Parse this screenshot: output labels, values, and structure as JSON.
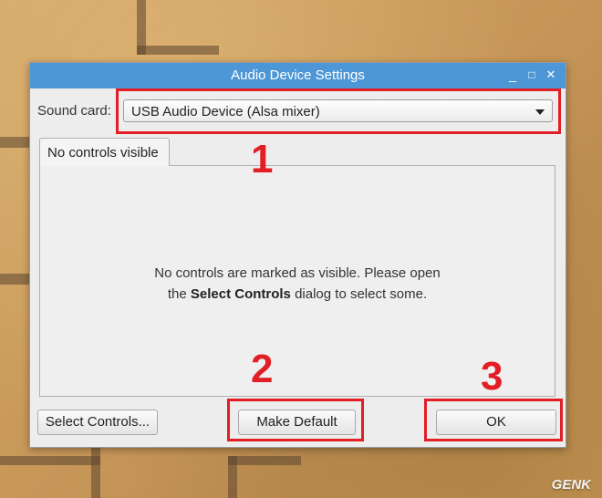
{
  "window": {
    "title": "Audio Device Settings",
    "controls": {
      "minimize": "_",
      "maximize": "□",
      "close": "✕"
    }
  },
  "sound_card": {
    "label": "Sound card:",
    "selected": "USB Audio Device (Alsa mixer)"
  },
  "tab": {
    "label": "No controls visible"
  },
  "panel": {
    "message_part1": "No controls are marked as visible. Please open",
    "message_part2_prefix": "the",
    "message_bold": "Select Controls",
    "message_part2_suffix": "dialog to select some."
  },
  "buttons": {
    "select_controls": "Select Controls...",
    "make_default": "Make Default",
    "ok": "OK"
  },
  "annotations": [
    "1",
    "2",
    "3"
  ],
  "watermark": "GENK",
  "colors": {
    "titlebar": "#4d97d6",
    "annotation_red": "#e21e26"
  }
}
